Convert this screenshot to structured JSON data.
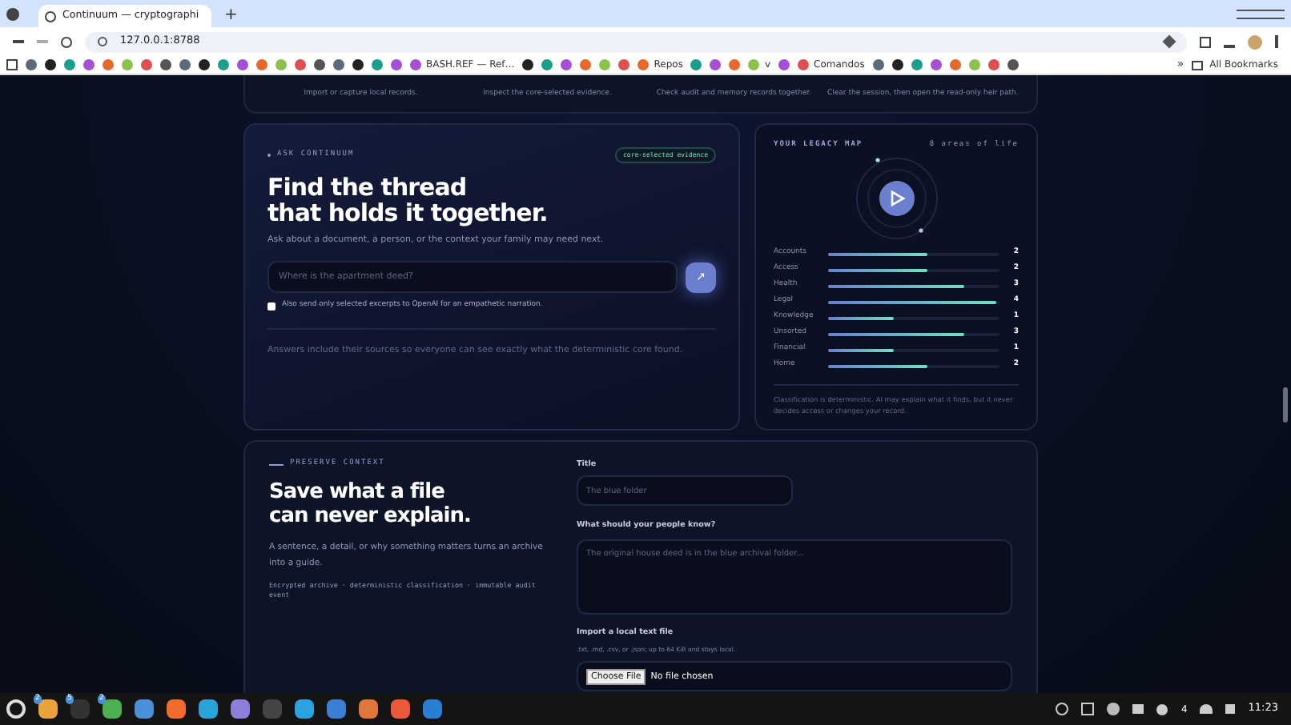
{
  "browser": {
    "tab_title": "Continuum — cryptographi",
    "new_tab": "+",
    "url": "127.0.0.1:8788",
    "bookmarks": [
      {
        "label": "BASH.REF — Ref…"
      },
      {
        "label": "Repos"
      },
      {
        "label": "v"
      },
      {
        "label": "Comandos"
      }
    ],
    "more": "»",
    "all_bookmarks": "All Bookmarks"
  },
  "steps": [
    "Import or capture local records.",
    "Inspect the core-selected evidence.",
    "Check audit and memory records together.",
    "Clear the session, then open the read-only heir path."
  ],
  "ask": {
    "eyebrow": "ASK CONTINUUM",
    "badge": "core-selected evidence",
    "title_lines": [
      "Find the thread",
      "that holds it together."
    ],
    "subtitle": "Ask about a document, a person, or the context your family may need next.",
    "placeholder": "Where is the apartment deed?",
    "submit": "↗",
    "openai_checkbox": {
      "label": "Also send only selected excerpts to OpenAI for an empathetic narration.",
      "checked": false
    },
    "note": "Answers include their sources so everyone can see exactly what the deterministic core found."
  },
  "legacy": {
    "title": "YOUR LEGACY MAP",
    "count": "8 areas of life",
    "areas": [
      {
        "name": "Accounts",
        "count": "2",
        "level": 0.58
      },
      {
        "name": "Access",
        "count": "2",
        "level": 0.58
      },
      {
        "name": "Health",
        "count": "3",
        "level": 0.79
      },
      {
        "name": "Legal",
        "count": "4",
        "level": 0.98
      },
      {
        "name": "Knowledge",
        "count": "1",
        "level": 0.38
      },
      {
        "name": "Unsorted",
        "count": "3",
        "level": 0.79
      },
      {
        "name": "Financial",
        "count": "1",
        "level": 0.38
      },
      {
        "name": "Home",
        "count": "2",
        "level": 0.58
      }
    ],
    "footnote": "Classification is deterministic. AI may explain what it finds, but it never decides access or changes your record."
  },
  "preserve": {
    "eyebrow": "PRESERVE CONTEXT",
    "title_lines": [
      "Save what a file",
      "can never explain."
    ],
    "body": "A sentence, a detail, or why something matters turns an archive into a guide.",
    "tags": "Encrypted archive · deterministic classification · immutable audit event",
    "title_label": "Title",
    "title_placeholder": "The blue folder",
    "know_label": "What should your people know?",
    "know_placeholder": "The original house deed is in the blue archival folder...",
    "import_label": "Import a local text file",
    "import_hint": ".txt, .md, .csv, or .json; up to 64 KiB and stays local.",
    "choose_file": "Choose File",
    "no_file": "No file chosen"
  },
  "taskbar": {
    "badges": [
      "2",
      "5",
      "2"
    ],
    "tray_count": "4",
    "clock": "11:23"
  }
}
